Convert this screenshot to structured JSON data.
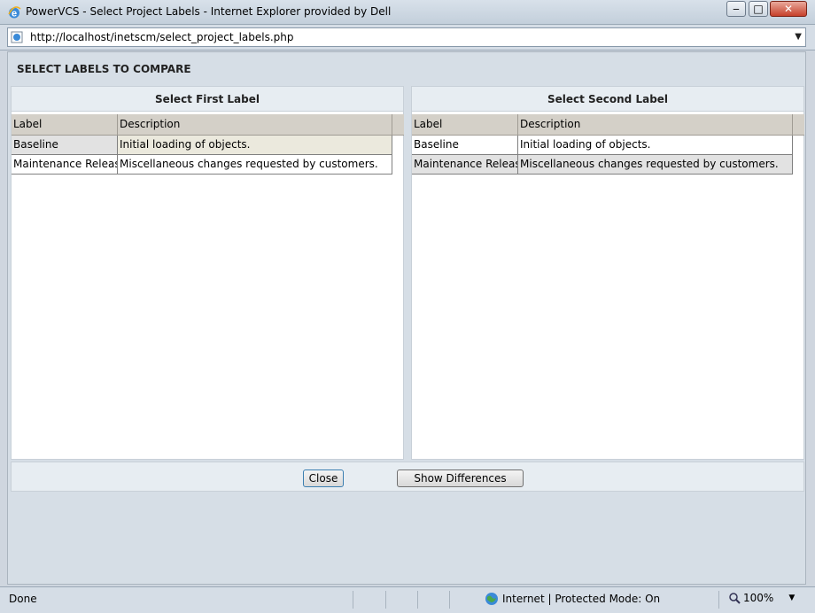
{
  "window": {
    "title": "PowerVCS - Select Project Labels - Internet Explorer provided by Dell",
    "min_glyph": "‒",
    "max_glyph": "□",
    "close_glyph": "✕"
  },
  "address": {
    "url": "http://localhost/inetscm/select_project_labels.php",
    "dropdown_glyph": "▼"
  },
  "page": {
    "heading": "SELECT LABELS TO COMPARE",
    "left_pane": {
      "title": "Select First Label",
      "columns": [
        "Label",
        "Description"
      ],
      "rows": [
        {
          "label": "Baseline",
          "description": "Initial loading of objects."
        },
        {
          "label": "Maintenance Release",
          "description": "Miscellaneous changes requested by customers."
        }
      ]
    },
    "right_pane": {
      "title": "Select Second Label",
      "columns": [
        "Label",
        "Description"
      ],
      "rows": [
        {
          "label": "Baseline",
          "description": "Initial loading of objects."
        },
        {
          "label": "Maintenance Release",
          "description": "Miscellaneous changes requested by customers."
        }
      ]
    },
    "buttons": {
      "close": "Close",
      "show_differences": "Show Differences"
    }
  },
  "statusbar": {
    "status": "Done",
    "zone": "Internet | Protected Mode: On",
    "zoom": "100%",
    "zoom_chevron": "▼"
  },
  "colors": {
    "selected_row": "#ebe9dd",
    "header_bg": "#d4d0c8",
    "pane_title_bg": "#e7edf2"
  }
}
